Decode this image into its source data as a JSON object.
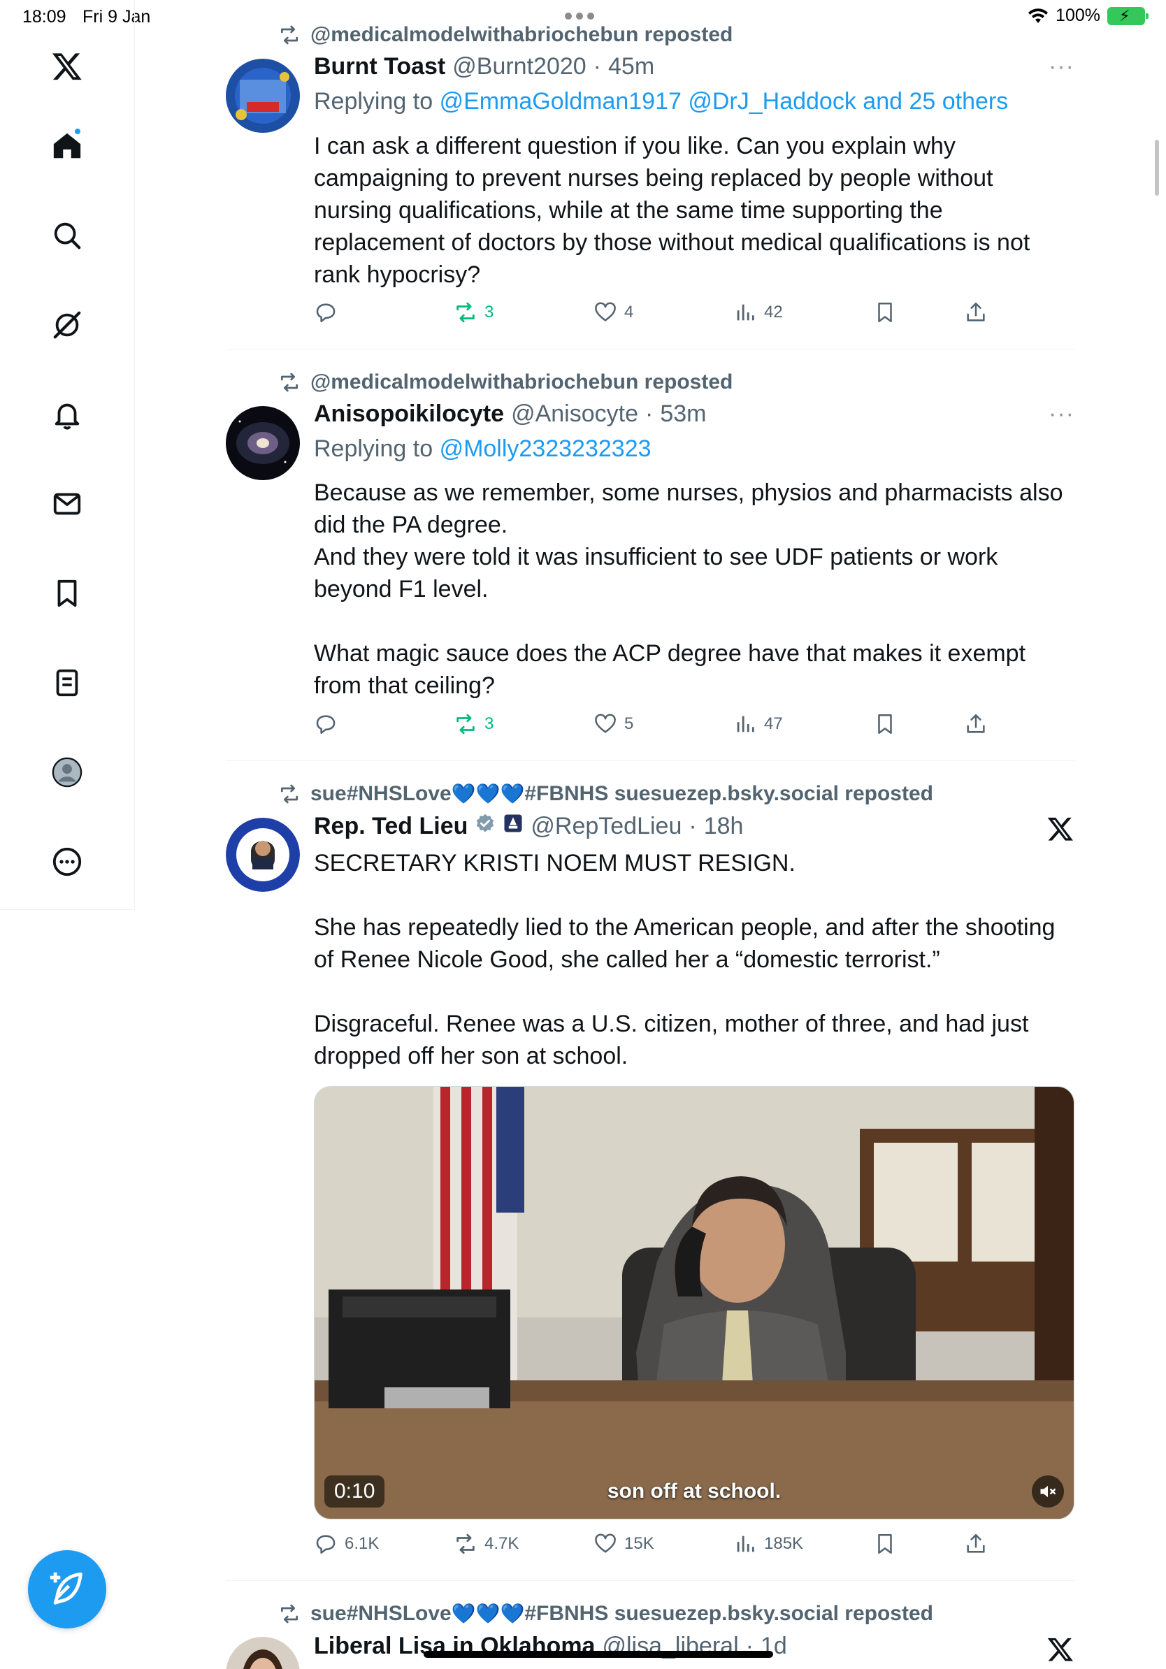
{
  "status_bar": {
    "time": "18:09",
    "date": "Fri 9 Jan",
    "battery": "100%"
  },
  "sidebar": {
    "items": [
      {
        "name": "home",
        "icon": "home-icon"
      },
      {
        "name": "explore",
        "icon": "search-icon"
      },
      {
        "name": "grok",
        "icon": "grok-icon"
      },
      {
        "name": "notifications",
        "icon": "bell-icon"
      },
      {
        "name": "messages",
        "icon": "mail-icon"
      },
      {
        "name": "bookmarks",
        "icon": "bookmark-icon"
      },
      {
        "name": "lists",
        "icon": "list-icon"
      },
      {
        "name": "profile",
        "icon": "profile-icon"
      },
      {
        "name": "more",
        "icon": "more-circle-icon"
      }
    ],
    "compose_icon": "compose-icon"
  },
  "tweets": [
    {
      "reposted_by": "@medicalmodelwithabriochebun reposted",
      "name": "Burnt Toast",
      "handle": "@Burnt2020",
      "sep": "·",
      "ago": "45m",
      "replying_prefix": "Replying to",
      "replying_mentions": "@EmmaGoldman1917 @DrJ_Haddock and 25 others",
      "text": "I can ask a different question if you like. Can you explain why campaigning to prevent nurses being replaced by people without nursing qualifications, while at the same time supporting the replacement of doctors by those without medical qualifications is not rank hypocrisy?",
      "reposts": "3",
      "likes": "4",
      "views": "42",
      "more": "···"
    },
    {
      "reposted_by": "@medicalmodelwithabriochebun reposted",
      "name": "Anisopoikilocyte",
      "handle": "@Anisocyte",
      "sep": "·",
      "ago": "53m",
      "replying_prefix": "Replying to",
      "replying_mentions": "@Molly2323232323",
      "text": "Because as we remember, some nurses, physios and pharmacists also did the PA degree.\nAnd they were told it was insufficient to see UDF patients or work beyond F1 level.\n\nWhat magic sauce does the ACP degree have that makes it exempt from that ceiling?",
      "reposts": "3",
      "likes": "5",
      "views": "47",
      "more": "···"
    },
    {
      "reposted_by_prefix": "sue#NHSLove",
      "reposted_by_suffix": "#FBNHS suesuezep.bsky.social reposted",
      "hearts": "💙💙💙",
      "name": "Rep. Ted Lieu",
      "handle": "@RepTedLieu",
      "sep": "·",
      "ago": "18h",
      "text": "SECRETARY KRISTI NOEM MUST RESIGN.\n\nShe has repeatedly lied to the American people, and after the shooting of Renee Nicole Good, she called her a “domestic terrorist.”\n\nDisgraceful. Renee was a U.S. citizen, mother of three, and had just dropped off her son at school.",
      "video_time": "0:10",
      "video_caption": "son off at school.",
      "replies": "6.1K",
      "reposts": "4.7K",
      "likes": "15K",
      "views": "185K"
    },
    {
      "reposted_by_prefix": "sue#NHSLove",
      "reposted_by_suffix": "#FBNHS suesuezep.bsky.social reposted",
      "hearts": "💙💙💙",
      "name": "Liberal Lisa in Oklahoma",
      "handle": "@lisa_liberal",
      "sep": "·",
      "ago": "1d"
    }
  ],
  "colors": {
    "accent": "#1d9bf0",
    "repost_green": "#00ba7c",
    "muted": "#536471"
  }
}
